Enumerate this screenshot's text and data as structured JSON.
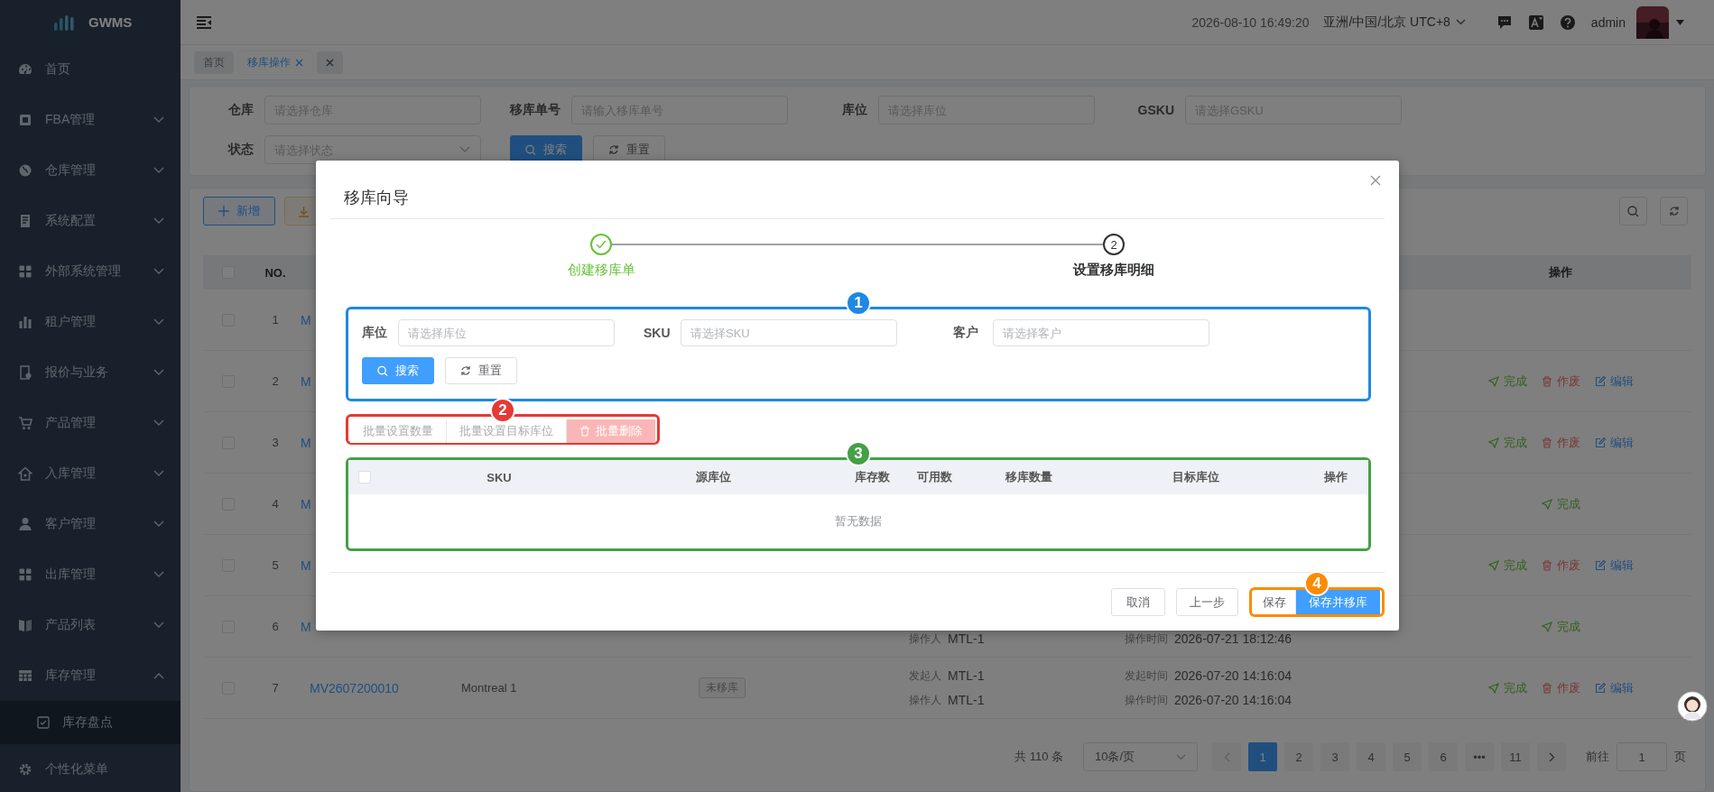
{
  "sidebar": {
    "logo": "GWMS",
    "items": [
      {
        "label": "首页",
        "kind": "link"
      },
      {
        "label": "FBA管理",
        "kind": "group",
        "expanded": false
      },
      {
        "label": "仓库管理",
        "kind": "group",
        "expanded": false
      },
      {
        "label": "系统配置",
        "kind": "group",
        "expanded": false
      },
      {
        "label": "外部系统管理",
        "kind": "group",
        "expanded": false
      },
      {
        "label": "租户管理",
        "kind": "group",
        "expanded": false
      },
      {
        "label": "报价与业务",
        "kind": "group",
        "expanded": false
      },
      {
        "label": "产品管理",
        "kind": "group",
        "expanded": false
      },
      {
        "label": "入库管理",
        "kind": "group",
        "expanded": false
      },
      {
        "label": "客户管理",
        "kind": "group",
        "expanded": false
      },
      {
        "label": "出库管理",
        "kind": "group",
        "expanded": false
      },
      {
        "label": "产品列表",
        "kind": "group",
        "expanded": false
      },
      {
        "label": "库存管理",
        "kind": "group",
        "expanded": true,
        "children": [
          {
            "label": "库存盘点"
          }
        ]
      },
      {
        "label": "个性化菜单",
        "kind": "link"
      }
    ]
  },
  "header": {
    "datetime": "2026-08-10 16:49:20",
    "timezone": "亚洲/中国/北京 UTC+8",
    "user": "admin"
  },
  "tags": [
    {
      "label": "首页",
      "kind": "page",
      "selected": false
    },
    {
      "label": "移库操作",
      "kind": "page",
      "selected": true
    },
    {
      "kind": "close_all",
      "selected": false
    }
  ],
  "filters": {
    "fields": [
      {
        "label": "仓库",
        "placeholder": "请选择仓库",
        "kind": "input"
      },
      {
        "label": "移库单号",
        "placeholder": "请输入移库单号",
        "kind": "input"
      },
      {
        "label": "库位",
        "placeholder": "请选择库位",
        "kind": "input"
      },
      {
        "label": "GSKU",
        "placeholder": "请选择GSKU",
        "kind": "input"
      },
      {
        "label": "状态",
        "placeholder": "请选择状态",
        "kind": "select"
      }
    ],
    "search": "搜索",
    "reset": "重置"
  },
  "toolbar": {
    "add": "新增"
  },
  "table": {
    "all_checked": false,
    "columns": {
      "no": "NO.",
      "actions": "操作"
    },
    "rows": [
      {
        "no": "1",
        "checked": false,
        "order": "M",
        "actions": []
      },
      {
        "no": "2",
        "checked": false,
        "order": "M",
        "actions": [
          {
            "kind": "complete",
            "label": "完成"
          },
          {
            "kind": "void",
            "label": "作废"
          },
          {
            "kind": "edit",
            "label": "编辑"
          }
        ]
      },
      {
        "no": "3",
        "checked": false,
        "order": "M",
        "actions": [
          {
            "kind": "complete",
            "label": "完成"
          },
          {
            "kind": "void",
            "label": "作废"
          },
          {
            "kind": "edit",
            "label": "编辑"
          }
        ]
      },
      {
        "no": "4",
        "checked": false,
        "order": "M",
        "actions": [
          {
            "kind": "complete",
            "label": "完成"
          }
        ]
      },
      {
        "no": "5",
        "checked": false,
        "order": "M",
        "actions": [
          {
            "kind": "complete",
            "label": "完成"
          },
          {
            "kind": "void",
            "label": "作废"
          },
          {
            "kind": "edit",
            "label": "编辑"
          }
        ]
      },
      {
        "no": "6",
        "checked": false,
        "order": "M",
        "operator_label": "操作人",
        "operator": "MTL-1",
        "op_time_label": "操作时间",
        "op_time": "2026-07-21 18:12:46",
        "actions": [
          {
            "kind": "complete",
            "label": "完成"
          }
        ]
      },
      {
        "no": "7",
        "checked": false,
        "order": "MV2607200010",
        "warehouse": "Montreal 1",
        "status": "未移库",
        "initiator_label": "发起人",
        "initiator": "MTL-1",
        "operator_label": "操作人",
        "operator": "MTL-1",
        "start_time_label": "发起时间",
        "start_time": "2026-07-20 14:16:04",
        "op_time_label": "操作时间",
        "op_time": "2026-07-20 14:16:04",
        "actions": [
          {
            "kind": "complete",
            "label": "完成"
          },
          {
            "kind": "void",
            "label": "作废"
          },
          {
            "kind": "edit",
            "label": "编辑"
          }
        ]
      }
    ]
  },
  "pagination": {
    "total": "共 110 条",
    "page_size": "10条/页",
    "pages": [
      {
        "label": "1",
        "selected": true
      },
      {
        "label": "2",
        "selected": false
      },
      {
        "label": "3",
        "selected": false
      },
      {
        "label": "4",
        "selected": false
      },
      {
        "label": "5",
        "selected": false
      },
      {
        "label": "6",
        "selected": false
      },
      {
        "label": "•••",
        "selected": false
      },
      {
        "label": "11",
        "selected": false
      }
    ],
    "goto_label": "前往",
    "goto_value": "1",
    "goto_suffix": "页"
  },
  "dialog": {
    "title": "移库向导",
    "steps": [
      {
        "label": "创建移库单",
        "done": true
      },
      {
        "label": "设置移库明细",
        "number": "2",
        "done": false
      }
    ],
    "search_panel": {
      "callout": {
        "label": "1",
        "color": "#1e88e5"
      },
      "fields": [
        {
          "label": "库位",
          "placeholder": "请选择库位"
        },
        {
          "label": "SKU",
          "placeholder": "请选择SKU"
        },
        {
          "label": "客户",
          "placeholder": "请选择客户"
        }
      ],
      "search": "搜索",
      "reset": "重置"
    },
    "batch_actions": {
      "callout": {
        "label": "2",
        "color": "#e53935"
      },
      "buttons": [
        {
          "label": "批量设置数量",
          "kind": "plain",
          "disabled": true
        },
        {
          "label": "批量设置目标库位",
          "kind": "plain",
          "disabled": true
        },
        {
          "label": "批量删除",
          "kind": "danger",
          "disabled": true
        }
      ]
    },
    "detail_table": {
      "callout": {
        "label": "3",
        "color": "#43a047"
      },
      "all_checked": false,
      "columns": [
        "SKU",
        "源库位",
        "库存数",
        "可用数",
        "移库数量",
        "目标库位",
        "操作"
      ],
      "empty": "暂无数据"
    },
    "footer": {
      "buttons": [
        {
          "label": "取消"
        },
        {
          "label": "上一步"
        }
      ],
      "callout": {
        "label": "4",
        "color": "#fb8c00"
      },
      "save_buttons": [
        {
          "label": "保存",
          "kind": "default"
        },
        {
          "label": "保存并移库",
          "kind": "primary"
        }
      ]
    }
  }
}
